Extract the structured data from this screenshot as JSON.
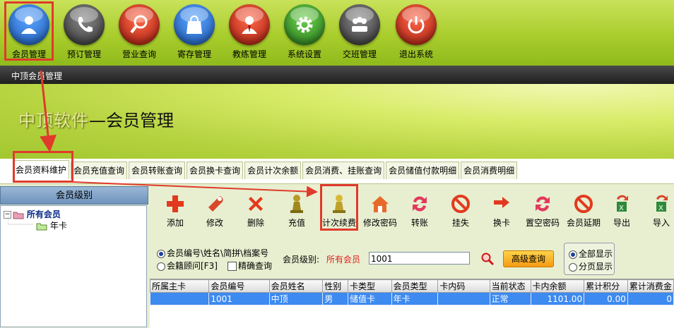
{
  "toolbar": {
    "items": [
      {
        "label": "会员管理",
        "icon": "member-icon",
        "color": "#2f77d6"
      },
      {
        "label": "预订管理",
        "icon": "phone-icon",
        "color": "#5a5a5a"
      },
      {
        "label": "营业查询",
        "icon": "magnifier-icon",
        "color": "#d13a22"
      },
      {
        "label": "寄存管理",
        "icon": "bag-icon",
        "color": "#2f77d6"
      },
      {
        "label": "教练管理",
        "icon": "coach-icon",
        "color": "#d13a22"
      },
      {
        "label": "系统设置",
        "icon": "gear-icon",
        "color": "#3f9a2a"
      },
      {
        "label": "交班管理",
        "icon": "handover-icon",
        "color": "#5a5a5a"
      },
      {
        "label": "退出系统",
        "icon": "power-icon",
        "color": "#d13a22"
      }
    ]
  },
  "breadcrumb": "中顶会员管理",
  "hero": {
    "brand": "中顶软件",
    "title": "—会员管理"
  },
  "tabs": [
    "会员资料维护",
    "会员充值查询",
    "会员转账查询",
    "会员换卡查询",
    "会员计次余额",
    "会员消费、挂账查询",
    "会员储值付款明细",
    "会员消费明细"
  ],
  "left_panel": {
    "header": "会员级别",
    "tree_root": "所有会员",
    "tree_child": "年卡"
  },
  "actions": [
    {
      "label": "添加",
      "icon": "plus-icon"
    },
    {
      "label": "修改",
      "icon": "wrench-icon"
    },
    {
      "label": "删除",
      "icon": "cross-icon"
    },
    {
      "label": "充值",
      "icon": "pawn-icon"
    },
    {
      "label": "计次续费",
      "icon": "pawn-gold-icon"
    },
    {
      "label": "修改密码",
      "icon": "house-icon"
    },
    {
      "label": "转账",
      "icon": "transfer-icon"
    },
    {
      "label": "挂失",
      "icon": "forbidden-icon"
    },
    {
      "label": "换卡",
      "icon": "swap-icon"
    },
    {
      "label": "置空密码",
      "icon": "reset-icon"
    },
    {
      "label": "会员延期",
      "icon": "forbidden-icon"
    },
    {
      "label": "导出",
      "icon": "export-icon"
    },
    {
      "label": "导入",
      "icon": "import-icon"
    }
  ],
  "search": {
    "radio_code": "会员编号\\姓名\\简拼\\档案号",
    "radio_advisor": "会籍顾问[F3]",
    "exact": "精确查询",
    "level_label": "会员级别:",
    "level_value": "所有会员",
    "input_value": "1001",
    "adv_button": "高级查询",
    "show_all": "全部显示",
    "show_paged": "分页显示"
  },
  "table": {
    "headers": [
      "所属主卡",
      "会员编号",
      "会员姓名",
      "性别",
      "卡类型",
      "会员类型",
      "卡内码",
      "当前状态",
      "卡内余额",
      "累计积分",
      "累计消费金"
    ],
    "rows": [
      [
        "",
        "1001",
        "中顶",
        "男",
        "储值卡",
        "年卡",
        "",
        "正常",
        "1101.00",
        "0.00",
        "0"
      ]
    ]
  }
}
